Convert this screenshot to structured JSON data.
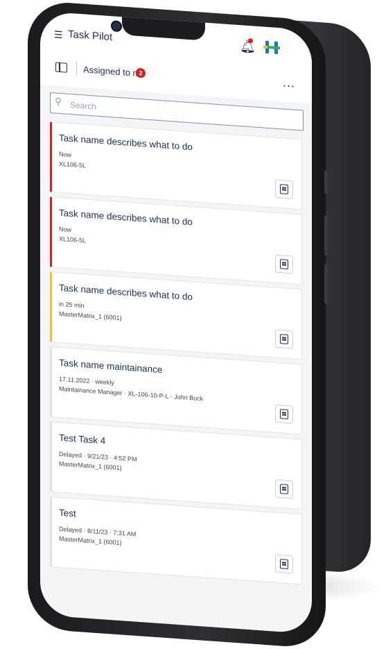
{
  "app": {
    "title": "Task Pilot"
  },
  "toolbar": {
    "filter_label": "Assigned to me",
    "filter_count": "2",
    "more": "..."
  },
  "search": {
    "placeholder": "Search"
  },
  "tasks": [
    {
      "title": "Task name describes what to do",
      "meta1": "Now",
      "meta2": "XL106-5L",
      "status": "red"
    },
    {
      "title": "Task name describes what to do",
      "meta1": "Now",
      "meta2": "XL106-5L",
      "status": "red"
    },
    {
      "title": "Task name describes what to do",
      "meta1": "in 25 min",
      "meta2": "MasterMatrix_1 (6001)",
      "status": "yellow"
    },
    {
      "title": "Task name maintainance",
      "meta1": "17.11.2022 · weekly",
      "meta2": "Maintainance Manager · XL-106-10-P-L · John Bock",
      "status": "grey"
    },
    {
      "title": "Test Task 4",
      "meta1": "Delayed · 9/21/23 · 4:52 PM",
      "meta2": "MasterMatrix_1 (6001)",
      "status": "grey"
    },
    {
      "title": "Test",
      "meta1": "Delayed · 8/11/23 · 7:31 AM",
      "meta2": "MasterMatrix_1 (6001)",
      "status": "grey"
    }
  ],
  "colors": {
    "urgent": "#d61f26",
    "soon": "#f2c12e",
    "primary": "#1d2f4f",
    "badge": "#d81e1e"
  },
  "icons": {
    "menu": "menu-icon",
    "bell": "bell-icon",
    "panel": "panel-toggle-icon",
    "search": "search-icon",
    "more": "more-icon",
    "task_action": "machine-icon"
  }
}
